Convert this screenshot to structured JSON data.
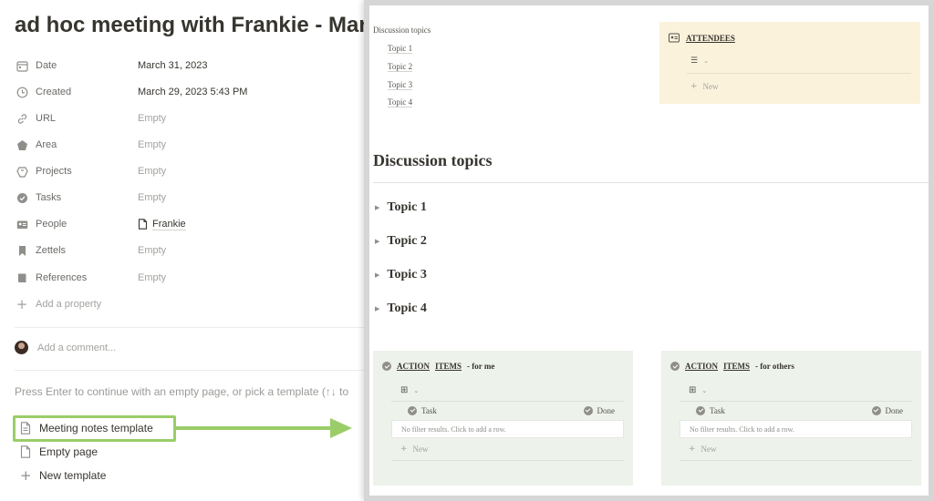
{
  "left": {
    "title": "ad hoc meeting with Frankie - Mar",
    "properties": [
      {
        "icon": "calendar-icon",
        "name": "Date",
        "value": "March 31, 2023",
        "empty": false
      },
      {
        "icon": "clock-icon",
        "name": "Created",
        "value": "March 29, 2023 5:43 PM",
        "empty": false
      },
      {
        "icon": "link-icon",
        "name": "URL",
        "value": "Empty",
        "empty": true
      },
      {
        "icon": "pentagon-icon",
        "name": "Area",
        "value": "Empty",
        "empty": true
      },
      {
        "icon": "projects-icon",
        "name": "Projects",
        "value": "Empty",
        "empty": true
      },
      {
        "icon": "check-circle-icon",
        "name": "Tasks",
        "value": "Empty",
        "empty": true
      },
      {
        "icon": "contact-card-icon",
        "name": "People",
        "value": "Frankie",
        "empty": false
      },
      {
        "icon": "bookmark-icon",
        "name": "Zettels",
        "value": "Empty",
        "empty": true
      },
      {
        "icon": "book-icon",
        "name": "References",
        "value": "Empty",
        "empty": true
      }
    ],
    "add_property": "Add a property",
    "comment_placeholder": "Add a comment...",
    "hint": "Press Enter to continue with an empty page, or pick a template (↑↓ to",
    "templates": {
      "meeting_notes": "Meeting notes template",
      "empty_page": "Empty page",
      "new_template": "New template"
    }
  },
  "right": {
    "toc": {
      "title": "Discussion topics",
      "items": [
        "Topic 1",
        "Topic 2",
        "Topic 3",
        "Topic 4"
      ]
    },
    "attendees": {
      "title": "ATTENDEES",
      "new_label": "New"
    },
    "heading": "Discussion topics",
    "topics": [
      "Topic 1",
      "Topic 2",
      "Topic 3",
      "Topic 4"
    ],
    "action_boxes": [
      {
        "title_a": "ACTION",
        "title_b": "ITEMS",
        "suffix": " - for me",
        "col_task": "Task",
        "col_done": "Done",
        "empty": "No filter results. Click to add a row.",
        "new_label": "New"
      },
      {
        "title_a": "ACTION",
        "title_b": "ITEMS",
        "suffix": " - for others",
        "col_task": "Task",
        "col_done": "Done",
        "empty": "No filter results. Click to add a row.",
        "new_label": "New"
      }
    ]
  },
  "colors": {
    "highlight_green": "#9acd68",
    "attendees_bg": "#fbf2dc",
    "action_bg": "#edf2ea"
  }
}
